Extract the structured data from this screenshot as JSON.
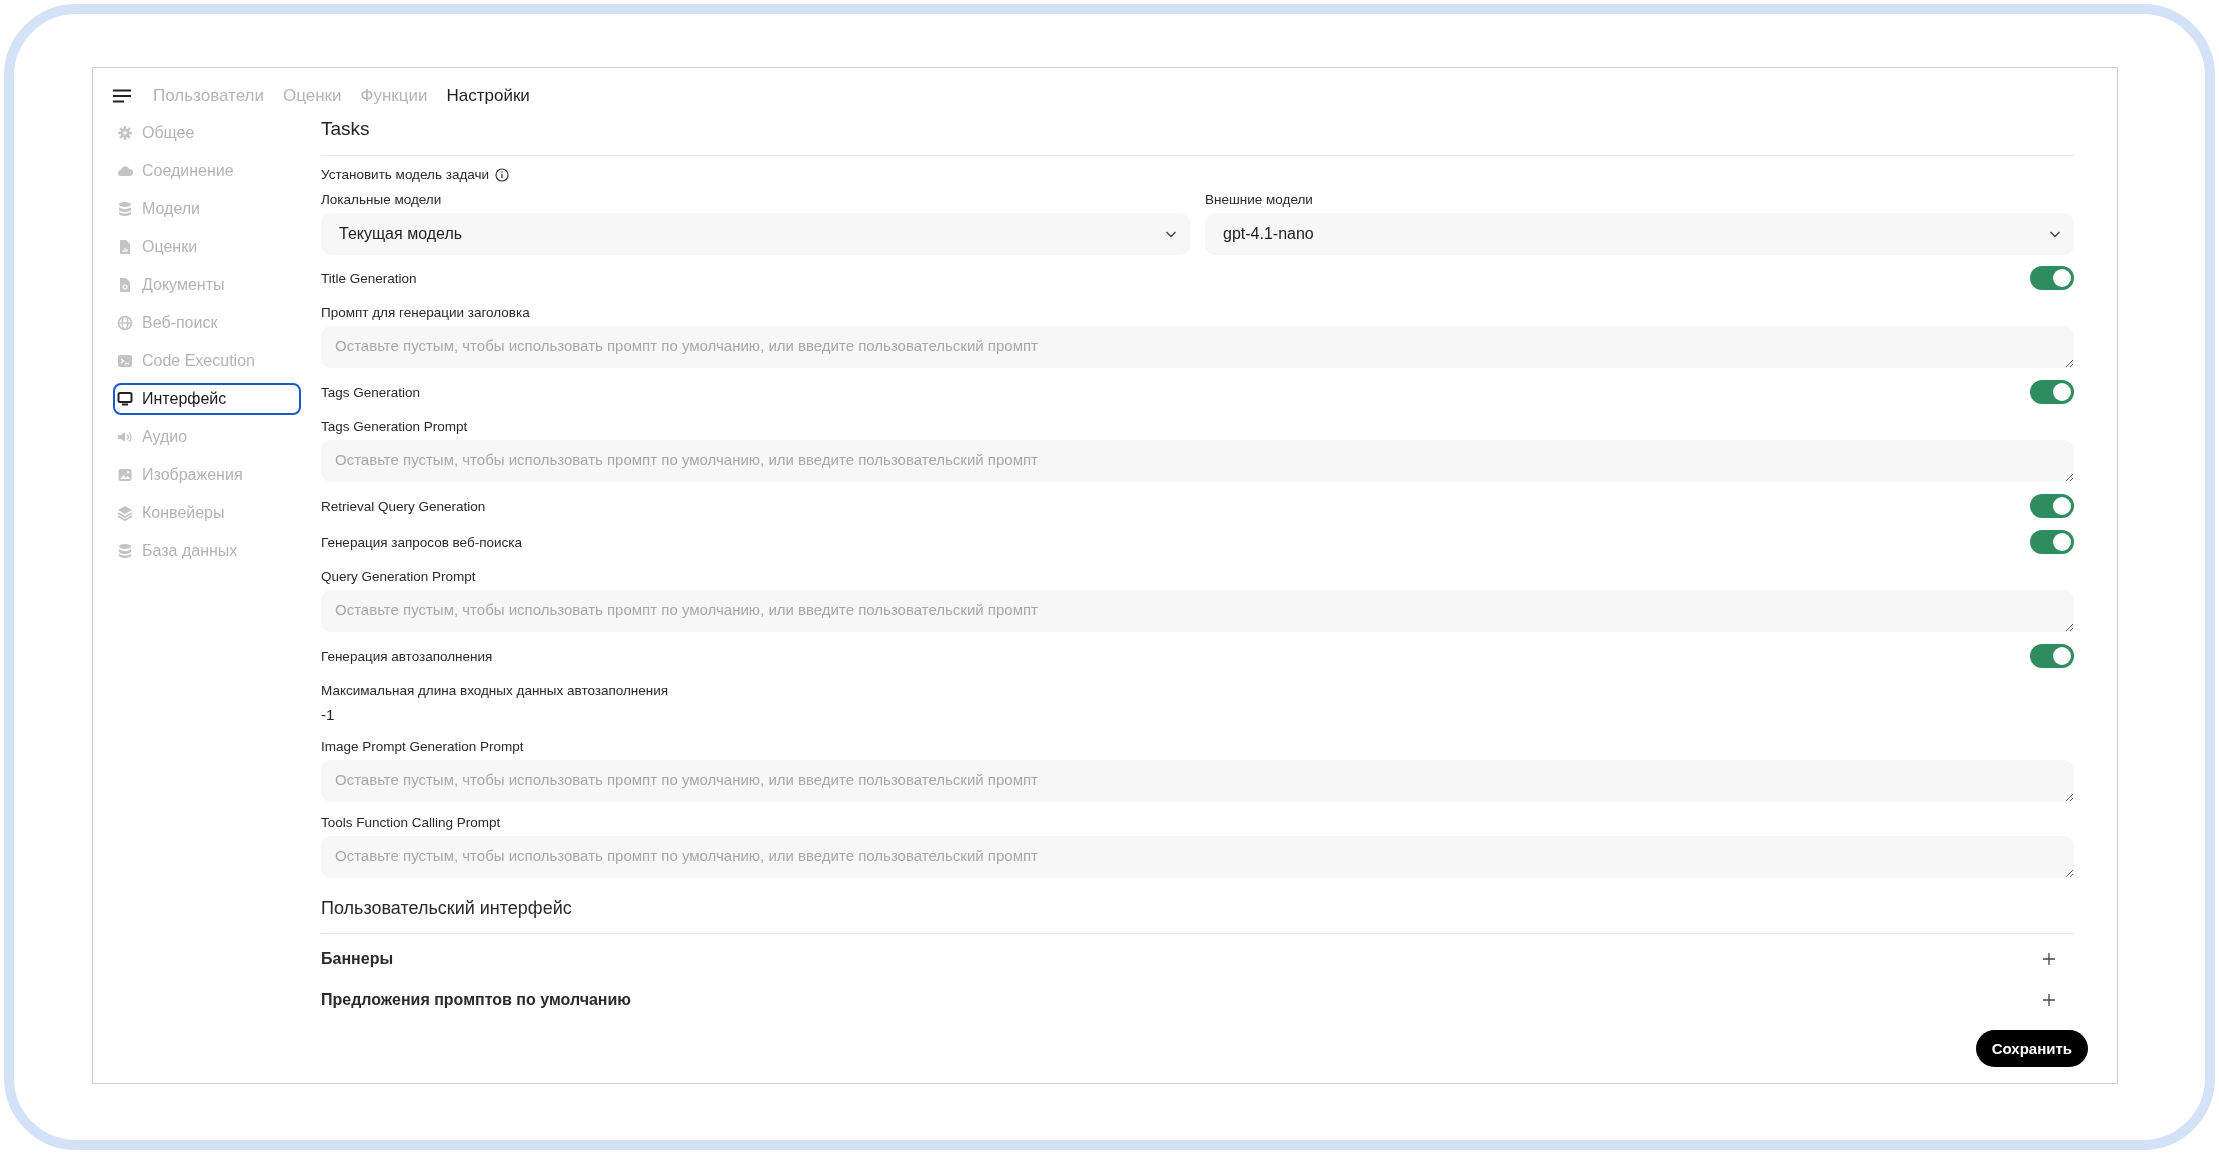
{
  "nav": {
    "tabs": [
      {
        "label": "Пользователи",
        "selected": false
      },
      {
        "label": "Оценки",
        "selected": false
      },
      {
        "label": "Функции",
        "selected": false
      },
      {
        "label": "Настройки",
        "selected": true
      }
    ]
  },
  "sidebar": {
    "items": [
      {
        "label": "Общее",
        "selected": false
      },
      {
        "label": "Соединение",
        "selected": false
      },
      {
        "label": "Модели",
        "selected": false
      },
      {
        "label": "Оценки",
        "selected": false
      },
      {
        "label": "Документы",
        "selected": false
      },
      {
        "label": "Веб-поиск",
        "selected": false
      },
      {
        "label": "Code Execution",
        "selected": false
      },
      {
        "label": "Интерфейс",
        "selected": true
      },
      {
        "label": "Аудио",
        "selected": false
      },
      {
        "label": "Изображения",
        "selected": false
      },
      {
        "label": "Конвейеры",
        "selected": false
      },
      {
        "label": "База данных",
        "selected": false
      }
    ]
  },
  "tasks": {
    "title": "Tasks",
    "task_model": {
      "label": "Установить модель задачи",
      "local": {
        "label": "Локальные модели",
        "value": "Текущая модель"
      },
      "external": {
        "label": "Внешние модели",
        "value": "gpt-4.1-nano"
      }
    },
    "settings": [
      {
        "kind": "toggle",
        "label": "Title Generation",
        "on": true
      },
      {
        "kind": "prompt",
        "label": "Промпт для генерации заголовка",
        "placeholder": "Оставьте пустым, чтобы использовать промпт по умолчанию, или введите пользовательский промпт"
      },
      {
        "kind": "toggle",
        "label": "Tags Generation",
        "on": true
      },
      {
        "kind": "prompt",
        "label": "Tags Generation Prompt",
        "placeholder": "Оставьте пустым, чтобы использовать промпт по умолчанию, или введите пользовательский промпт"
      },
      {
        "kind": "toggle",
        "label": "Retrieval Query Generation",
        "on": true
      },
      {
        "kind": "toggle",
        "label": "Генерация запросов веб-поиска",
        "on": true
      },
      {
        "kind": "prompt",
        "label": "Query Generation Prompt",
        "placeholder": "Оставьте пустым, чтобы использовать промпт по умолчанию, или введите пользовательский промпт"
      },
      {
        "kind": "toggle",
        "label": "Генерация автозаполнения",
        "on": true
      },
      {
        "kind": "value",
        "label": "Максимальная длина входных данных автозаполнения",
        "value": "-1"
      },
      {
        "kind": "prompt",
        "label": "Image Prompt Generation Prompt",
        "placeholder": "Оставьте пустым, чтобы использовать промпт по умолчанию, или введите пользовательский промпт"
      },
      {
        "kind": "prompt",
        "label": "Tools Function Calling Prompt",
        "placeholder": "Оставьте пустым, чтобы использовать промпт по умолчанию, или введите пользовательский промпт"
      }
    ]
  },
  "interface": {
    "title": "Пользовательский интерфейс",
    "sections": [
      {
        "label": "Баннеры"
      },
      {
        "label": "Предложения промптов по умолчанию"
      }
    ]
  },
  "save_button": "Сохранить"
}
